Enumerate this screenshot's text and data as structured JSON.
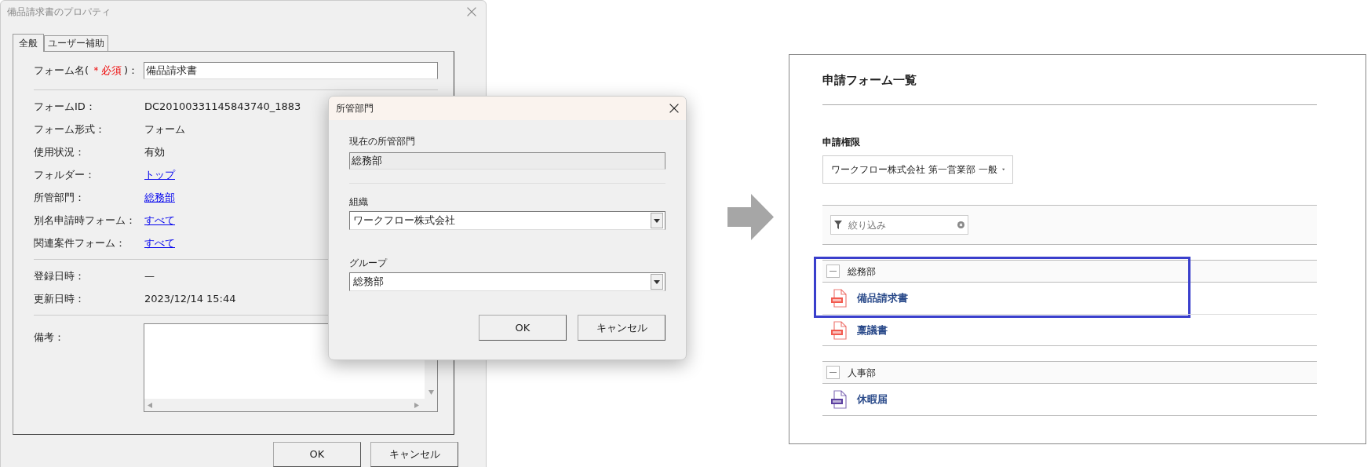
{
  "properties_dialog": {
    "title": "備品請求書のプロパティ",
    "tabs": [
      {
        "label": "全般",
        "selected": true
      },
      {
        "label": "ユーザー補助",
        "selected": false
      }
    ],
    "form_name": {
      "label_prefix": "フォーム名(",
      "required_mark": "＊必須",
      "label_suffix": ")：",
      "value": "備品請求書"
    },
    "sections": [
      [
        {
          "label": "フォームID：",
          "value": "DC20100331145843740_1883",
          "kind": "text"
        },
        {
          "label": "フォーム形式：",
          "value": "フォーム",
          "kind": "text"
        },
        {
          "label": "使用状況：",
          "value": "有効",
          "kind": "text"
        },
        {
          "label": "フォルダー：",
          "value": "トップ",
          "kind": "link"
        },
        {
          "label": "所管部門：",
          "value": "総務部",
          "kind": "link"
        },
        {
          "label": "別名申請時フォーム：",
          "value": "すべて",
          "kind": "link"
        },
        {
          "label": "関連案件フォーム：",
          "value": "すべて",
          "kind": "link"
        }
      ],
      [
        {
          "label": "登録日時：",
          "value": "—",
          "kind": "text"
        },
        {
          "label": "更新日時：",
          "value": "2023/12/14 15:44",
          "kind": "text"
        }
      ]
    ],
    "remarks": {
      "label": "備考："
    },
    "buttons": [
      "OK",
      "キャンセル"
    ]
  },
  "department_dialog": {
    "title": "所管部門",
    "current_label": "現在の所管部門",
    "current_value": "総務部",
    "organization_label": "組織",
    "organization_value": "ワークフロー株式会社",
    "group_label": "グループ",
    "group_value": "総務部",
    "buttons": [
      "OK",
      "キャンセル"
    ]
  },
  "form_list": {
    "title": "申請フォーム一覧",
    "permission_label": "申請権限",
    "permission_value": "ワークフロー株式会社 第一営業部 一般",
    "filter_placeholder": "絞り込み",
    "groups": [
      {
        "name": "総務部",
        "expanded": true,
        "forms": [
          {
            "name": "備品請求書",
            "kind": "pdf",
            "highlighted": true
          },
          {
            "name": "稟議書",
            "kind": "pdf",
            "highlighted": false
          }
        ]
      },
      {
        "name": "人事部",
        "expanded": true,
        "forms": [
          {
            "name": "休暇届",
            "kind": "web",
            "highlighted": false
          }
        ]
      }
    ]
  }
}
